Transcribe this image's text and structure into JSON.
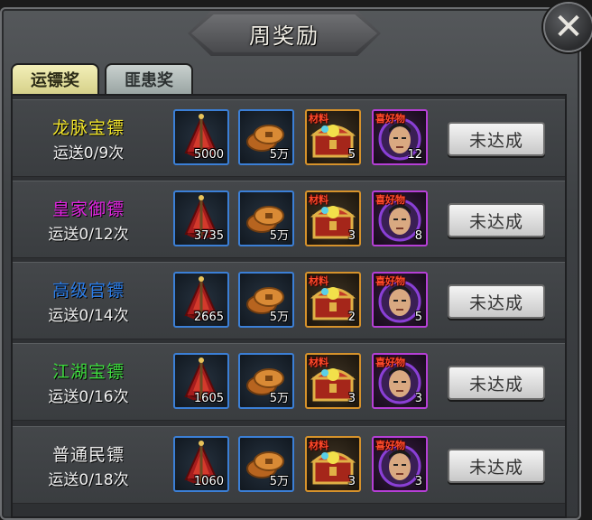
{
  "title": "周奖励",
  "tabs": [
    {
      "label": "运镖奖",
      "active": true
    },
    {
      "label": "匪患奖",
      "active": false
    }
  ],
  "colors": {
    "row_name_yellow": "#f0e32a",
    "row_name_magenta": "#e023e0",
    "row_name_blue": "#2c7de8",
    "row_name_green": "#3fdc3f",
    "row_name_white": "#eeeeee"
  },
  "rows": [
    {
      "name": "龙脉宝镖",
      "name_color": "#f0e32a",
      "progress": "运送0/9次",
      "items": [
        {
          "icon": "red-banner-icon",
          "qty": "5000"
        },
        {
          "icon": "copper-coins-icon",
          "qty": "5万"
        },
        {
          "icon": "treasure-chest-icon",
          "tag": "材料",
          "qty": "5"
        },
        {
          "icon": "character-portrait-icon",
          "tag": "喜好物",
          "qty": "12"
        }
      ],
      "status": "未达成"
    },
    {
      "name": "皇家御镖",
      "name_color": "#e023e0",
      "progress": "运送0/12次",
      "items": [
        {
          "icon": "red-banner-icon",
          "qty": "3735"
        },
        {
          "icon": "copper-coins-icon",
          "qty": "5万"
        },
        {
          "icon": "treasure-chest-icon",
          "tag": "材料",
          "qty": "3"
        },
        {
          "icon": "character-portrait-icon",
          "tag": "喜好物",
          "qty": "8"
        }
      ],
      "status": "未达成"
    },
    {
      "name": "高级官镖",
      "name_color": "#2c7de8",
      "progress": "运送0/14次",
      "items": [
        {
          "icon": "red-banner-icon",
          "qty": "2665"
        },
        {
          "icon": "copper-coins-icon",
          "qty": "5万"
        },
        {
          "icon": "treasure-chest-icon",
          "tag": "材料",
          "qty": "2"
        },
        {
          "icon": "character-portrait-icon",
          "tag": "喜好物",
          "qty": "5"
        }
      ],
      "status": "未达成"
    },
    {
      "name": "江湖宝镖",
      "name_color": "#3fdc3f",
      "progress": "运送0/16次",
      "items": [
        {
          "icon": "red-banner-icon",
          "qty": "1605"
        },
        {
          "icon": "copper-coins-icon",
          "qty": "5万"
        },
        {
          "icon": "treasure-chest-icon",
          "tag": "材料",
          "qty": "3"
        },
        {
          "icon": "character-portrait-icon",
          "tag": "喜好物",
          "qty": "3"
        }
      ],
      "status": "未达成"
    },
    {
      "name": "普通民镖",
      "name_color": "#eeeeee",
      "progress": "运送0/18次",
      "items": [
        {
          "icon": "red-banner-icon",
          "qty": "1060"
        },
        {
          "icon": "copper-coins-icon",
          "qty": "5万"
        },
        {
          "icon": "treasure-chest-icon",
          "tag": "材料",
          "qty": "3"
        },
        {
          "icon": "character-portrait-icon",
          "tag": "喜好物",
          "qty": "3"
        }
      ],
      "status": "未达成"
    }
  ]
}
